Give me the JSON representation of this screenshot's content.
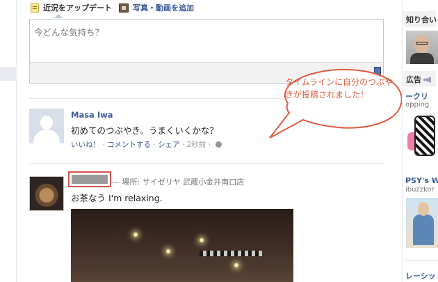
{
  "composer": {
    "tab_status_label": "近況をアップデート",
    "tab_photo_label": "写真・動画を追加",
    "placeholder": "今どんな気持ち？"
  },
  "annotation": {
    "callout_text": "タイムラインに自分のつぶやきが投稿されました！",
    "color": "#e05a3f"
  },
  "posts": [
    {
      "author": "Masa Iwa",
      "text": "初めてのつぶやき。うまくいくかな？",
      "like_label": "いいね！",
      "comment_label": "コメントする",
      "share_label": "シェア",
      "time": "2秒前",
      "sep": "·",
      "privacy_icon": "globe-icon"
    },
    {
      "author_redacted": true,
      "location_text": "— 場所: サイゼリヤ 武蔵小金井南口店",
      "text": "お茶なう I'm relaxing."
    }
  ],
  "right_column": {
    "friends_header": "知り合い",
    "ads_header": "広告",
    "ads": [
      {
        "title": "ークリ",
        "sub": "opping"
      },
      {
        "title": "PSY's Wi",
        "sub": "ibuzzkor"
      },
      {
        "title": "レーシッ",
        "sub": ""
      }
    ]
  },
  "colors": {
    "link": "#3b5998",
    "highlight_border": "#d9534f"
  }
}
